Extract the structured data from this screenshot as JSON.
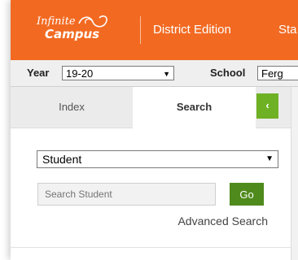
{
  "header": {
    "logo_line1": "Infinite",
    "logo_line2": "Campus",
    "edition": "District Edition",
    "cut_text": "Sta",
    "brand_color": "#f26a22"
  },
  "toolbar": {
    "year_label": "Year",
    "year_value": "19-20",
    "school_label": "School",
    "school_value": "Ferg"
  },
  "tabs": {
    "index_label": "Index",
    "search_label": "Search",
    "collapse_glyph": "‹"
  },
  "search": {
    "type_value": "Student",
    "placeholder": "Search Student",
    "go_label": "Go",
    "advanced_label": "Advanced Search"
  },
  "icons": {
    "dropdown_arrow": "▼",
    "logo_swoosh": "infinity-swoosh-icon"
  }
}
